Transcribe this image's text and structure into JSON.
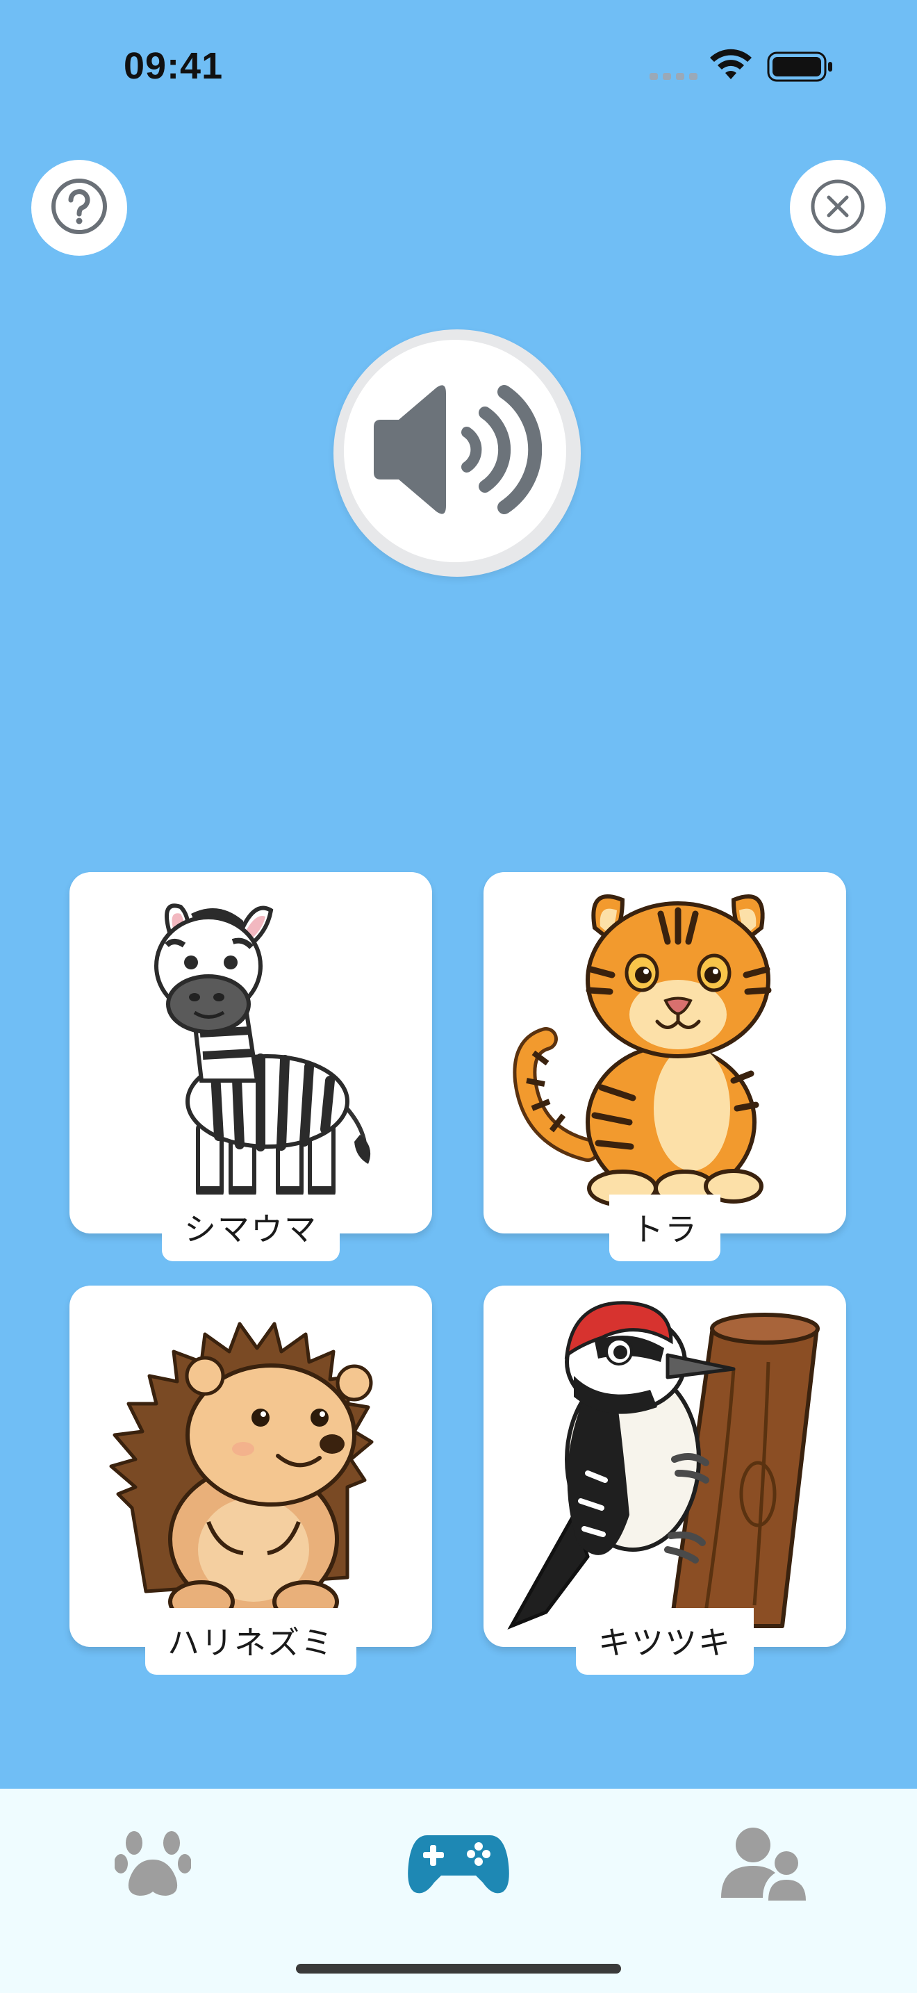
{
  "status_bar": {
    "time": "09:41"
  },
  "header": {
    "help_icon": "question-circle-icon",
    "close_icon": "x-circle-icon"
  },
  "sound": {
    "icon": "speaker-wave-icon"
  },
  "cards": [
    {
      "label": "シマウマ",
      "image": "zebra"
    },
    {
      "label": "トラ",
      "image": "tiger"
    },
    {
      "label": "ハリネズミ",
      "image": "hedgehog"
    },
    {
      "label": "キツツキ",
      "image": "woodpecker"
    }
  ],
  "tab_bar": {
    "tabs": [
      {
        "icon": "paw-icon",
        "active": false
      },
      {
        "icon": "gamepad-icon",
        "active": true
      },
      {
        "icon": "users-icon",
        "active": false
      }
    ],
    "active_color": "#1E88B4",
    "inactive_color": "#9E9E9E"
  },
  "colors": {
    "background": "#70BEF5",
    "tab_bar": "#EFFCFF"
  }
}
